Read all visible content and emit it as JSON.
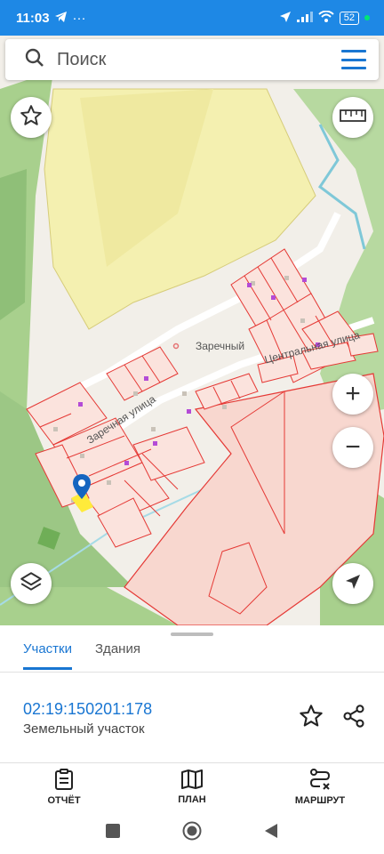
{
  "status_bar": {
    "time": "11:03",
    "more": "···",
    "battery": "52"
  },
  "search": {
    "placeholder": "Поиск"
  },
  "map": {
    "labels": {
      "settlement": "Заречный",
      "street_1": "Заречная улица",
      "street_2": "Центральная улица"
    },
    "zoom_in": "+",
    "zoom_out": "−"
  },
  "sheet": {
    "tabs": [
      {
        "label": "Участки",
        "active": true
      },
      {
        "label": "Здания",
        "active": false
      }
    ],
    "parcel": {
      "cadastral_number": "02:19:150201:178",
      "type": "Земельный участок"
    }
  },
  "bottom_nav": [
    {
      "label": "ОТЧЁТ",
      "icon": "report-icon"
    },
    {
      "label": "ПЛАН",
      "icon": "map-plan-icon"
    },
    {
      "label": "МАРШРУТ",
      "icon": "route-icon"
    }
  ],
  "colors": {
    "accent": "#1976d2",
    "status_bar": "#1e88e5",
    "parcel_stroke": "#e53935",
    "forest": "#a8d08d",
    "field": "#f4f0b0"
  }
}
